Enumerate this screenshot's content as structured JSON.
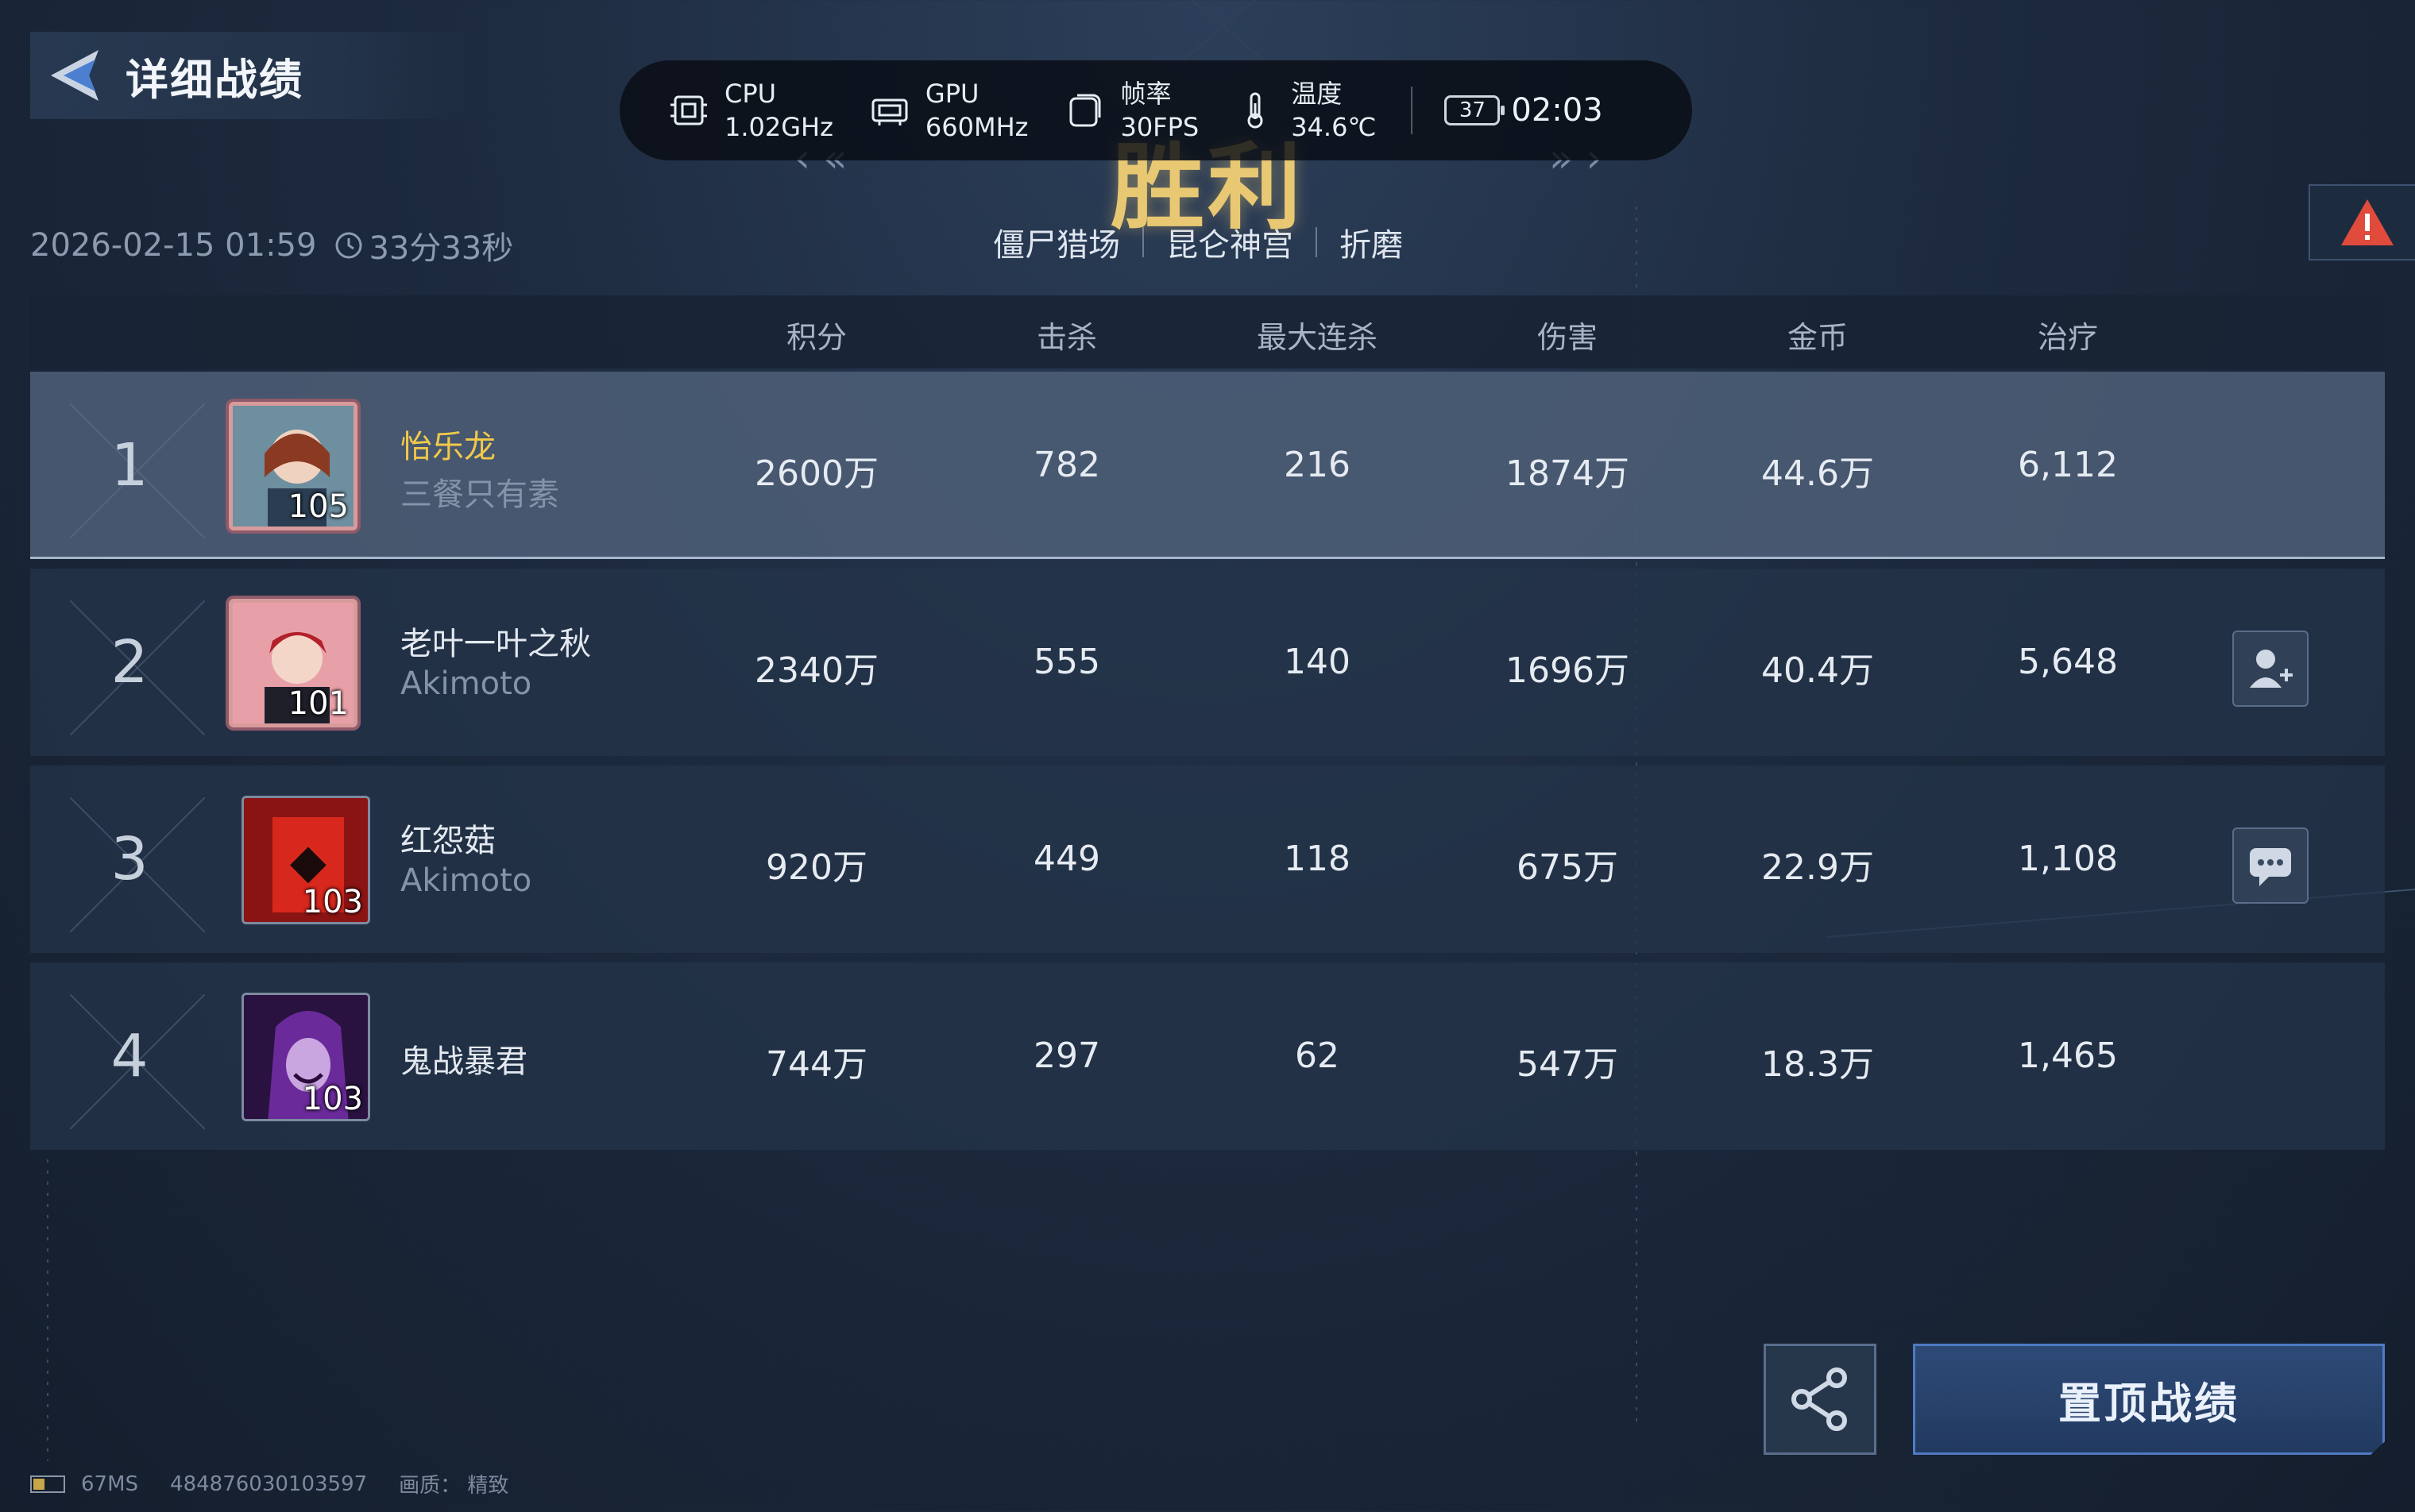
{
  "header": {
    "title": "详细战绩",
    "back_icon": "back-arrow-icon"
  },
  "performance": {
    "cpu_label": "CPU",
    "cpu_value": "1.02GHz",
    "gpu_label": "GPU",
    "gpu_value": "660MHz",
    "fps_label": "帧率",
    "fps_value": "30FPS",
    "temp_label": "温度",
    "temp_value": "34.6℃",
    "battery": "37",
    "time": "02:03"
  },
  "result": "胜利",
  "match": {
    "datetime": "2026-02-15 01:59",
    "duration": "33分33秒",
    "modes": [
      "僵尸猎场",
      "昆仑神宫",
      "折磨"
    ]
  },
  "columns": [
    "积分",
    "击杀",
    "最大连杀",
    "伤害",
    "金币",
    "治疗"
  ],
  "players": [
    {
      "rank": "1",
      "name": "怡乐龙",
      "subtitle": "三餐只有素",
      "level": "105",
      "score": "2600万",
      "kills": "782",
      "streak": "216",
      "damage": "1874万",
      "gold": "44.6万",
      "heal": "6,112"
    },
    {
      "rank": "2",
      "name": "老叶一叶之秋",
      "subtitle": "Akimoto",
      "level": "101",
      "score": "2340万",
      "kills": "555",
      "streak": "140",
      "damage": "1696万",
      "gold": "40.4万",
      "heal": "5,648"
    },
    {
      "rank": "3",
      "name": "红怨菇",
      "subtitle": "Akimoto",
      "level": "103",
      "score": "920万",
      "kills": "449",
      "streak": "118",
      "damage": "675万",
      "gold": "22.9万",
      "heal": "1,108"
    },
    {
      "rank": "4",
      "name": "鬼战暴君",
      "subtitle": "",
      "level": "103",
      "score": "744万",
      "kills": "297",
      "streak": "62",
      "damage": "547万",
      "gold": "18.3万",
      "heal": "1,465"
    }
  ],
  "buttons": {
    "pin": "置顶战绩"
  },
  "footer": {
    "ping": "67MS",
    "id": "484876030103597",
    "quality": "画质： 精致"
  },
  "colors": {
    "accent_gold": "#f1c94a",
    "victory": "#e9c873",
    "warning": "#e04b3c",
    "button_blue": "#2d4a77"
  }
}
